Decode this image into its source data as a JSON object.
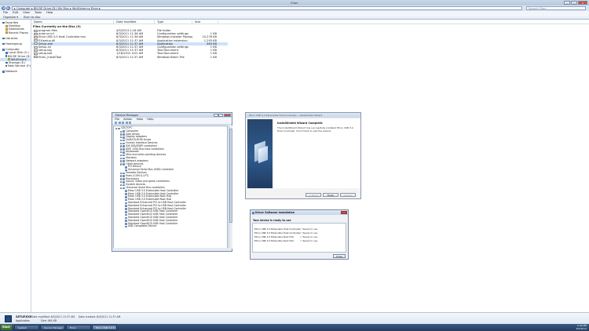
{
  "window": {
    "title": "Elron",
    "controls": [
      "—",
      "□",
      "✕"
    ]
  },
  "address": {
    "back_icon": "back-arrow-icon",
    "forward_icon": "forward-arrow-icon",
    "path": "▸ Computer ▸ BD-RE Drive (D:) My Disc ▸ WinDrivers ▸ Elron ▸",
    "search_placeholder": "Search Elron"
  },
  "menubar": [
    "File",
    "Edit",
    "View",
    "Tools",
    "Help"
  ],
  "toolbar": [
    "Organize ▾",
    "Burn to disc"
  ],
  "navpane": [
    {
      "label": "Favorites",
      "level": 0,
      "icon": "star"
    },
    {
      "label": "Desktop",
      "level": 1,
      "icon": "folder"
    },
    {
      "label": "Downloads",
      "level": 1,
      "icon": "folder"
    },
    {
      "label": "Recent Places",
      "level": 1,
      "icon": "folder"
    },
    {
      "label": "Libraries",
      "level": 0,
      "icon": "library",
      "gap": true
    },
    {
      "label": "Homegroup",
      "level": 0,
      "icon": "homegroup",
      "gap": true
    },
    {
      "label": "Computer",
      "level": 0,
      "icon": "computer",
      "gap": true
    },
    {
      "label": "Local Disk (C:)",
      "level": 1,
      "icon": "drive"
    },
    {
      "label": "BD-RE Drive (D:)",
      "level": 1,
      "icon": "drive"
    },
    {
      "label": "WinDrivers",
      "level": 2,
      "icon": "folder",
      "selected": true
    },
    {
      "label": "Storage (E:)",
      "level": 1,
      "icon": "drive"
    },
    {
      "label": "New Volume (F:)",
      "level": 1,
      "icon": "drive"
    },
    {
      "label": "Network",
      "level": 0,
      "icon": "network",
      "gap": true
    }
  ],
  "filelist": {
    "columns": [
      "Name",
      "Date modified",
      "Type",
      "Size"
    ],
    "group_header": "Files Currently on the Disc (9)",
    "rows": [
      {
        "name": "program files",
        "date": "4/5/2013 1:18 AM",
        "type": "File folder",
        "size": ""
      },
      {
        "name": "autorun.inf",
        "date": "8/3/2011 11:36 AM",
        "type": "Configuration settings",
        "size": "1 KB"
      },
      {
        "name": "Elron USB 3.0 Host Controller.msi",
        "date": "8/3/2011 11:36 AM",
        "type": "Windows Installer Package",
        "size": "10,276 KB"
      },
      {
        "name": "EXIsetup.dll",
        "date": "8/3/2011 11:37 AM",
        "type": "Application extension",
        "size": "1,293 KB"
      },
      {
        "name": "Setup.exe",
        "date": "8/3/2011 11:37 AM",
        "type": "Application",
        "size": "463 KB",
        "selected": true
      },
      {
        "name": "Setup.ini",
        "date": "8/3/2011 11:37 AM",
        "type": "Configuration settings",
        "size": "1 KB"
      },
      {
        "name": "setup.log",
        "date": "8/3/2011 11:37 AM",
        "type": "Text Document",
        "size": "1 KB"
      },
      {
        "name": "setup.bat",
        "date": "1/18/2012 4:01 AM",
        "type": "Text Document",
        "size": "1 KB"
      },
      {
        "name": "Etron_InstallTool",
        "date": "8/3/2011 11:37 AM",
        "type": "Windows Batch File",
        "size": "1 KB"
      }
    ]
  },
  "device_manager": {
    "title": "Device Manager",
    "menu": [
      "File",
      "Action",
      "View",
      "Help"
    ],
    "tree": [
      {
        "label": "CELTY-PC",
        "level": 0,
        "exp": "−"
      },
      {
        "label": "Computer",
        "level": 1,
        "exp": "+"
      },
      {
        "label": "Disk drives",
        "level": 1,
        "exp": "+"
      },
      {
        "label": "Display adapters",
        "level": 1,
        "exp": "+"
      },
      {
        "label": "DVD/CD-ROM drives",
        "level": 1,
        "exp": "+"
      },
      {
        "label": "Human Interface Devices",
        "level": 1,
        "exp": "+"
      },
      {
        "label": "IDE ATA/ATAPI controllers",
        "level": 1,
        "exp": "+"
      },
      {
        "label": "IEEE 1394 Bus host controllers",
        "level": 1,
        "exp": "+"
      },
      {
        "label": "Keyboards",
        "level": 1,
        "exp": "+"
      },
      {
        "label": "Mice and other pointing devices",
        "level": 1,
        "exp": "+"
      },
      {
        "label": "Monitors",
        "level": 1,
        "exp": "+"
      },
      {
        "label": "Network adapters",
        "level": 1,
        "exp": "+"
      },
      {
        "label": "Other devices",
        "level": 1,
        "exp": "−"
      },
      {
        "label": "PCI Device",
        "level": 2,
        "exp": ""
      },
      {
        "label": "Universal Serial Bus (USB) Controller",
        "level": 2,
        "exp": ""
      },
      {
        "label": "Portable Devices",
        "level": 1,
        "exp": "+"
      },
      {
        "label": "Ports (COM & LPT)",
        "level": 1,
        "exp": "+"
      },
      {
        "label": "Processors",
        "level": 1,
        "exp": "+"
      },
      {
        "label": "Sound, video and game controllers",
        "level": 1,
        "exp": "+"
      },
      {
        "label": "System devices",
        "level": 1,
        "exp": "+"
      },
      {
        "label": "Universal Serial Bus controllers",
        "level": 1,
        "exp": "−"
      },
      {
        "label": "Etron USB 3.0 Extensible Host Controller",
        "level": 2,
        "exp": ""
      },
      {
        "label": "Etron USB 3.0 Extensible Host Controller",
        "level": 2,
        "exp": ""
      },
      {
        "label": "Etron USB 3.0 Extensible Root Hub",
        "level": 2,
        "exp": ""
      },
      {
        "label": "Etron USB 3.0 Extensible Root Hub",
        "level": 2,
        "exp": ""
      },
      {
        "label": "Standard Enhanced PCI to USB Host Controller",
        "level": 2,
        "exp": ""
      },
      {
        "label": "Standard Enhanced PCI to USB Host Controller",
        "level": 2,
        "exp": ""
      },
      {
        "label": "Standard Enhanced PCI to USB Host Controller",
        "level": 2,
        "exp": ""
      },
      {
        "label": "Standard OpenHCD USB Host Controller",
        "level": 2,
        "exp": ""
      },
      {
        "label": "Standard OpenHCD USB Host Controller",
        "level": 2,
        "exp": ""
      },
      {
        "label": "Standard OpenHCD USB Host Controller",
        "level": 2,
        "exp": ""
      },
      {
        "label": "Standard OpenHCD USB Host Controller",
        "level": 2,
        "exp": ""
      },
      {
        "label": "Standard OpenHCD USB Host Controller",
        "level": 2,
        "exp": ""
      },
      {
        "label": "USB Composite Device",
        "level": 2,
        "exp": ""
      }
    ]
  },
  "wizard": {
    "title": "Etron USB 3.0 Extensible Host Controller - InstallShield Wizard",
    "heading": "InstallShield Wizard Complete",
    "text": "The InstallShield Wizard has successfully installed Etron USB 3.0 Host Controller. Click Finish to exit the wizard.",
    "buttons": [
      "< Back",
      "Finish",
      "Cancel"
    ]
  },
  "driver_dialog": {
    "title": "Driver Software Installation",
    "heading": "Your device is ready to use",
    "rows": [
      {
        "device": "Etron USB 3.0 Extensible Host Controller",
        "status": "Ready to use"
      },
      {
        "device": "Etron USB 3.0 Extensible Host Controller",
        "status": "Ready to use"
      },
      {
        "device": "Etron USB 3.0 Extensible Root Hub",
        "status": "Ready to use"
      },
      {
        "device": "Etron USB 3.0 Extensible Root Hub",
        "status": "Ready to use"
      }
    ],
    "close_label": "Close"
  },
  "details": {
    "name": "SETUP.EXE",
    "type": "Application",
    "date_modified_label": "Date modified: 8/3/2011 11:37 AM",
    "size_label": "Size: 464 KB",
    "date_created_label": "Date created: 8/3/2011 11:37 AM"
  },
  "taskbar": {
    "start": "Start",
    "items": [
      "System",
      "Device Manager",
      "Elron",
      "Etron USB 3.0 E..."
    ],
    "time": "2:40 PM",
    "date": "4/5/2013"
  }
}
